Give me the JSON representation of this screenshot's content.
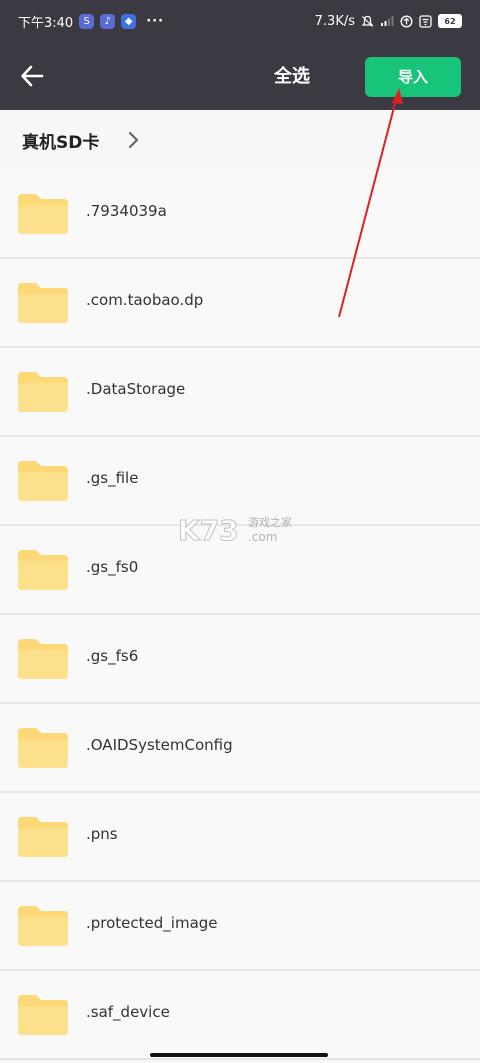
{
  "status_bar": {
    "time": "下午3:40",
    "dots": "···",
    "net_speed": "7.3K/s",
    "battery": "62"
  },
  "toolbar": {
    "select_all_label": "全选",
    "import_label": "导入",
    "accent_color": "#17c47a"
  },
  "path_bar": {
    "label": "真机SD卡"
  },
  "files": [
    {
      "name": ".7934039a",
      "icon": "folder-icon"
    },
    {
      "name": ".com.taobao.dp",
      "icon": "folder-icon"
    },
    {
      "name": ".DataStorage",
      "icon": "folder-icon"
    },
    {
      "name": ".gs_file",
      "icon": "folder-icon"
    },
    {
      "name": ".gs_fs0",
      "icon": "folder-icon"
    },
    {
      "name": ".gs_fs6",
      "icon": "folder-icon"
    },
    {
      "name": ".OAIDSystemConfig",
      "icon": "folder-icon"
    },
    {
      "name": ".pns",
      "icon": "folder-icon"
    },
    {
      "name": ".protected_image",
      "icon": "folder-icon"
    },
    {
      "name": ".saf_device",
      "icon": "folder-icon"
    }
  ],
  "watermark": {
    "logo": "K73",
    "sub_top": "游戏之家",
    "sub_bottom": ".com"
  }
}
